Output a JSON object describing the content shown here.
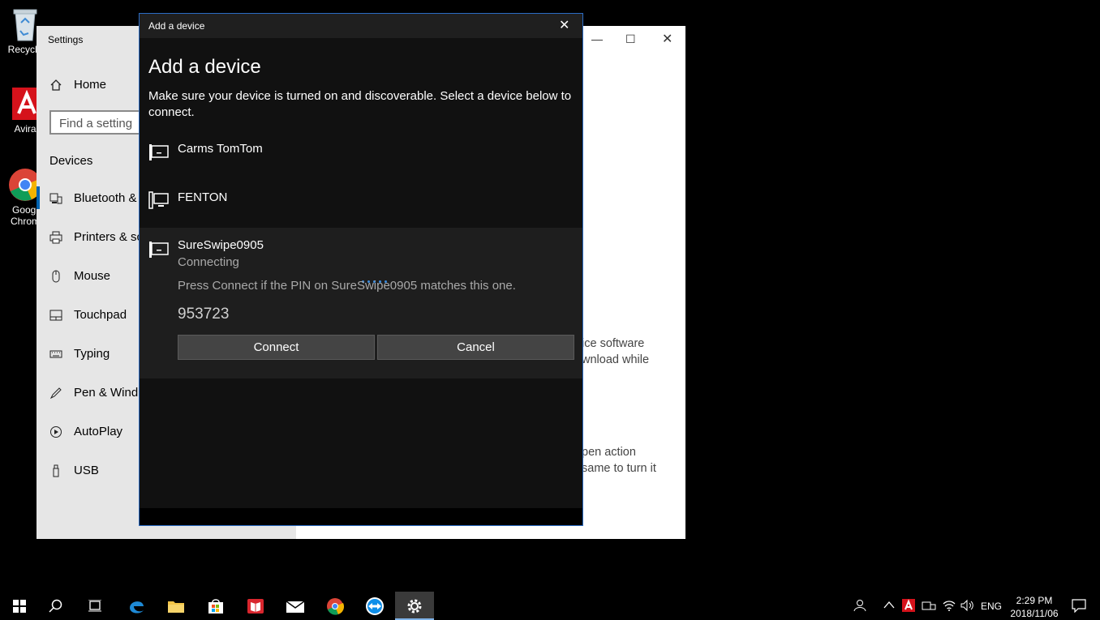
{
  "desktop": {
    "icons": [
      {
        "label": "Recycle"
      },
      {
        "label": "Avira"
      },
      {
        "label_line1": "Googl",
        "label_line2": "Chrom"
      }
    ]
  },
  "settings": {
    "title": "Settings",
    "home": "Home",
    "search_placeholder": "Find a setting",
    "section": "Devices",
    "items": [
      {
        "label": "Bluetooth &"
      },
      {
        "label": "Printers & sc"
      },
      {
        "label": "Mouse"
      },
      {
        "label": "Touchpad"
      },
      {
        "label": "Typing"
      },
      {
        "label": "Pen & Wind"
      },
      {
        "label": "AutoPlay"
      },
      {
        "label": "USB"
      }
    ],
    "right_text": {
      "block1_line1": "ice software",
      "block1_line2": "wnload while",
      "block2_line1": "pen action",
      "block2_line2": "same to turn it"
    }
  },
  "dialog": {
    "titlebar": "Add a device",
    "heading": "Add a device",
    "description": "Make sure your device is turned on and discoverable. Select a device below to connect.",
    "devices": [
      {
        "name": "Carms TomTom"
      },
      {
        "name": "FENTON"
      },
      {
        "name": "SureSwipe0905",
        "status": "Connecting"
      }
    ],
    "pin_prompt": "Press Connect if the PIN on SureSwipe0905 matches this one.",
    "pin": "953723",
    "connect_label": "Connect",
    "cancel_label": "Cancel"
  },
  "taskbar": {
    "language": "ENG",
    "time": "2:29 PM",
    "date": "2018/11/06"
  },
  "colors": {
    "accent": "#0063b1",
    "dialog_border": "#2b6cc4",
    "progress_dots": "#3b8de0"
  }
}
